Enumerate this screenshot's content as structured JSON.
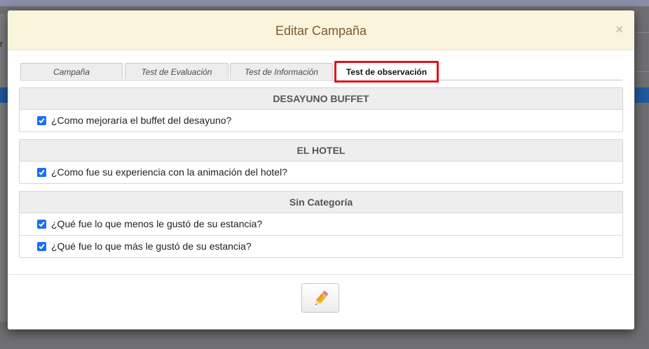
{
  "background": {
    "left_char": "r"
  },
  "modal": {
    "title": "Editar Campaña",
    "close_label": "×",
    "tabs": [
      {
        "label": "Campaña"
      },
      {
        "label": "Test de Evaluación"
      },
      {
        "label": "Test de Información"
      },
      {
        "label": "Test de observación",
        "active": true
      }
    ],
    "sections": [
      {
        "title": "DESAYUNO BUFFET",
        "items": [
          {
            "label": "¿Como mejoraría el buffet del desayuno?",
            "checked": true
          }
        ]
      },
      {
        "title": "EL HOTEL",
        "items": [
          {
            "label": "¿Como fue su experiencia con la animación del hotel?",
            "checked": true
          }
        ]
      },
      {
        "title": "Sin Categoría",
        "items": [
          {
            "label": "¿Qué fue lo que menos le gustó de su estancia?",
            "checked": true
          },
          {
            "label": "¿Qué fue lo que más le gustó de su estancia?",
            "checked": true
          }
        ]
      }
    ],
    "footer": {
      "edit_icon": "pencil-icon"
    }
  },
  "colors": {
    "header_bg": "#fbf4dc",
    "title_color": "#7b5a2f",
    "highlight": "#e3101b",
    "checkbox": "#1a6ef5"
  }
}
